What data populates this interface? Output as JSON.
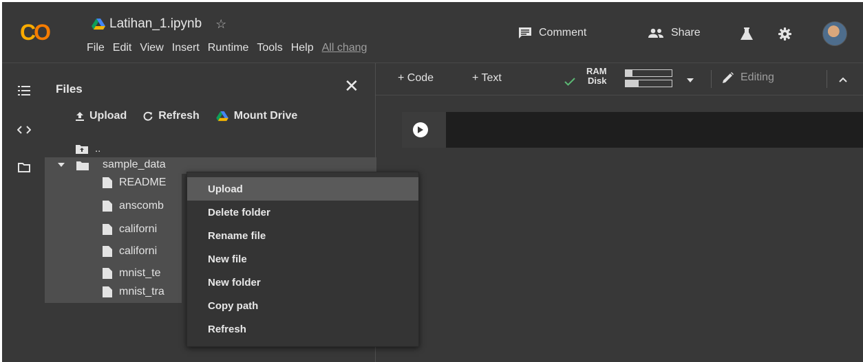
{
  "app": {
    "logo_text": "CO",
    "notebook_title": "Latihan_1.ipynb",
    "star_icon": "star-outline-icon",
    "menu": [
      "File",
      "Edit",
      "View",
      "Insert",
      "Runtime",
      "Tools",
      "Help"
    ],
    "changes_link": "All chang",
    "comment_label": "Comment",
    "share_label": "Share"
  },
  "files_panel": {
    "title": "Files",
    "upload_label": "Upload",
    "refresh_label": "Refresh",
    "mount_label": "Mount Drive",
    "parent_label": "..",
    "folder_name": "sample_data",
    "items": [
      "README",
      "anscomb",
      "californi",
      "californi",
      "mnist_te",
      "mnist_tra"
    ]
  },
  "toolbar": {
    "code_label": "+ Code",
    "text_label": "+ Text",
    "ram_label": "RAM",
    "disk_label": "Disk",
    "ram_fill": 0.15,
    "disk_fill": 0.28,
    "editing_label": "Editing"
  },
  "context_menu": {
    "items": [
      "Upload",
      "Delete folder",
      "Rename file",
      "New file",
      "New folder",
      "Copy path",
      "Refresh"
    ],
    "highlighted": "Upload"
  },
  "colors": {
    "background": "#383838",
    "logo_yellow": "#f9ab00",
    "logo_orange": "#f57c00",
    "drive_green": "#0f9d58",
    "drive_yellow": "#f4b400",
    "drive_blue": "#4285f4",
    "check_green": "#5bb974"
  }
}
